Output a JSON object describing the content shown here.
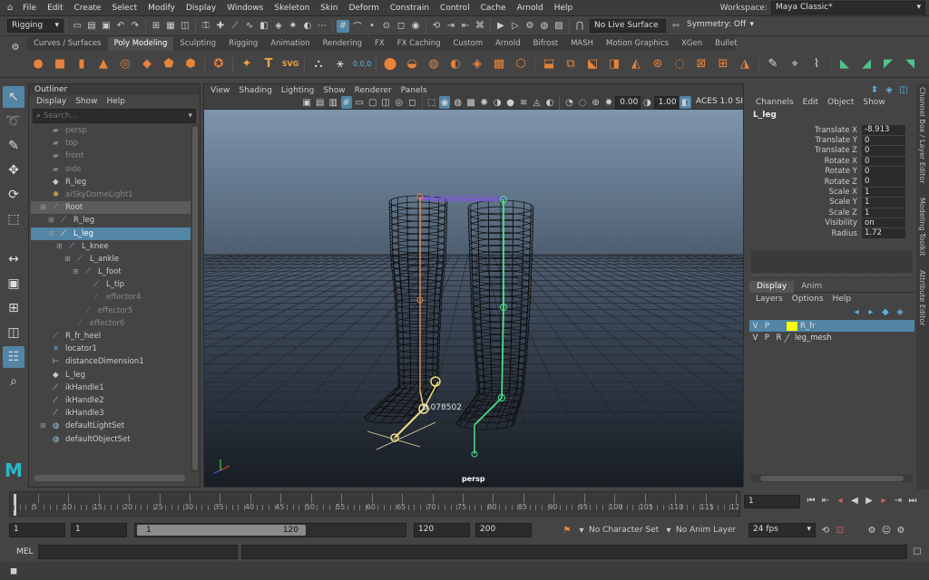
{
  "menubar": {
    "items": [
      "File",
      "Edit",
      "Create",
      "Select",
      "Modify",
      "Display",
      "Windows",
      "Skeleton",
      "Skin",
      "Deform",
      "Constrain",
      "Control",
      "Cache",
      "Arnold",
      "Help"
    ],
    "workspace_label": "Workspace:",
    "workspace_value": "Maya Classic*"
  },
  "statusline": {
    "menuset": "Rigging",
    "live_surface": "No Live Surface",
    "symmetry": "Symmetry: Off"
  },
  "shelf": {
    "tabs": [
      "Curves / Surfaces",
      "Poly Modeling",
      "Sculpting",
      "Rigging",
      "Animation",
      "Rendering",
      "FX",
      "FX Caching",
      "Custom",
      "Arnold",
      "Bifrost",
      "MASH",
      "Motion Graphics",
      "XGen",
      "Bullet"
    ],
    "active_tab": "Poly Modeling"
  },
  "outliner": {
    "title": "Outliner",
    "menu": [
      "Display",
      "Show",
      "Help"
    ],
    "search_placeholder": "Search...",
    "items": [
      {
        "label": "persp",
        "indent": 0,
        "icon": "camera-icon",
        "state": "dim"
      },
      {
        "label": "top",
        "indent": 0,
        "icon": "camera-icon",
        "state": "dim"
      },
      {
        "label": "front",
        "indent": 0,
        "icon": "camera-icon",
        "state": "dim"
      },
      {
        "label": "side",
        "indent": 0,
        "icon": "camera-icon",
        "state": "dim"
      },
      {
        "label": "R_leg",
        "indent": 0,
        "icon": "mesh-icon",
        "state": ""
      },
      {
        "label": "aiSkyDomeLight1",
        "indent": 0,
        "icon": "light-icon",
        "state": "dim"
      },
      {
        "label": "Root",
        "indent": 0,
        "icon": "joint-icon",
        "state": "hl",
        "expand": "-"
      },
      {
        "label": "R_leg",
        "indent": 1,
        "icon": "joint-icon",
        "state": "",
        "expand": "+"
      },
      {
        "label": "L_leg",
        "indent": 1,
        "icon": "joint-icon",
        "state": "sel",
        "expand": "-"
      },
      {
        "label": "L_knee",
        "indent": 2,
        "icon": "joint-icon",
        "state": "",
        "expand": "-"
      },
      {
        "label": "L_ankle",
        "indent": 3,
        "icon": "joint-icon",
        "state": "",
        "expand": "-"
      },
      {
        "label": "L_foot",
        "indent": 4,
        "icon": "joint-icon",
        "state": "",
        "expand": "-"
      },
      {
        "label": "L_tip",
        "indent": 5,
        "icon": "joint-icon",
        "state": ""
      },
      {
        "label": "effector4",
        "indent": 5,
        "icon": "effector-icon",
        "state": "dim"
      },
      {
        "label": "effector5",
        "indent": 4,
        "icon": "effector-icon",
        "state": "dim"
      },
      {
        "label": "effector6",
        "indent": 3,
        "icon": "effector-icon",
        "state": "dim"
      },
      {
        "label": "R_fr_heel",
        "indent": 0,
        "icon": "joint-icon",
        "state": ""
      },
      {
        "label": "locator1",
        "indent": 0,
        "icon": "locator-icon",
        "state": ""
      },
      {
        "label": "distanceDimension1",
        "indent": 0,
        "icon": "dimension-icon",
        "state": ""
      },
      {
        "label": "L_leg",
        "indent": 0,
        "icon": "mesh-icon",
        "state": ""
      },
      {
        "label": "ikHandle1",
        "indent": 0,
        "icon": "ikhandle-icon",
        "state": ""
      },
      {
        "label": "ikHandle2",
        "indent": 0,
        "icon": "ikhandle-icon",
        "state": ""
      },
      {
        "label": "ikHandle3",
        "indent": 0,
        "icon": "ikhandle-icon",
        "state": ""
      },
      {
        "label": "defaultLightSet",
        "indent": 0,
        "icon": "set-icon",
        "state": "",
        "expand": "+"
      },
      {
        "label": "defaultObjectSet",
        "indent": 0,
        "icon": "set-icon",
        "state": ""
      }
    ]
  },
  "viewport": {
    "menu": [
      "View",
      "Shading",
      "Lighting",
      "Show",
      "Renderer",
      "Panels"
    ],
    "exposure": "0.00",
    "gamma": "1.00",
    "colorspace": "ACES 1.0 SI",
    "camera_label": "persp",
    "distance_readout": "8.078502"
  },
  "channelbox": {
    "menu": [
      "Channels",
      "Edit",
      "Object",
      "Show"
    ],
    "object": "L_leg",
    "channels": [
      {
        "name": "Translate X",
        "value": "-8.913"
      },
      {
        "name": "Translate Y",
        "value": "0"
      },
      {
        "name": "Translate Z",
        "value": "0"
      },
      {
        "name": "Rotate X",
        "value": "0"
      },
      {
        "name": "Rotate Y",
        "value": "0"
      },
      {
        "name": "Rotate Z",
        "value": "0"
      },
      {
        "name": "Scale X",
        "value": "1"
      },
      {
        "name": "Scale Y",
        "value": "1"
      },
      {
        "name": "Scale Z",
        "value": "1"
      },
      {
        "name": "Visibility",
        "value": "on"
      },
      {
        "name": "Radius",
        "value": "1.72"
      }
    ]
  },
  "layers": {
    "tabs": [
      "Display",
      "Anim"
    ],
    "menu": [
      "Layers",
      "Options",
      "Help"
    ],
    "rows": [
      {
        "v": "V",
        "p": "P",
        "r": "",
        "name": "R_fr",
        "color": "#ffff00",
        "selected": true
      },
      {
        "v": "V",
        "p": "P",
        "r": "R",
        "name": "leg_mesh",
        "color": "",
        "selected": false
      }
    ]
  },
  "sidetabs": [
    "Channel Box / Layer Editor",
    "Modeling Toolkit",
    "Attribute Editor"
  ],
  "timeline": {
    "ticks": [
      "5",
      "10",
      "15",
      "20",
      "25",
      "30",
      "35",
      "40",
      "45",
      "50",
      "55",
      "60",
      "65",
      "70",
      "75",
      "80",
      "85",
      "90",
      "95",
      "100",
      "105",
      "110",
      "115",
      "12"
    ],
    "current_frame": "1"
  },
  "range": {
    "start": "1",
    "playback_start": "1",
    "slider_start": "1",
    "slider_end": "120",
    "playback_end": "120",
    "end": "200",
    "character_set": "No Character Set",
    "anim_layer": "No Anim Layer",
    "fps": "24 fps"
  },
  "cmdline": {
    "label": "MEL"
  }
}
